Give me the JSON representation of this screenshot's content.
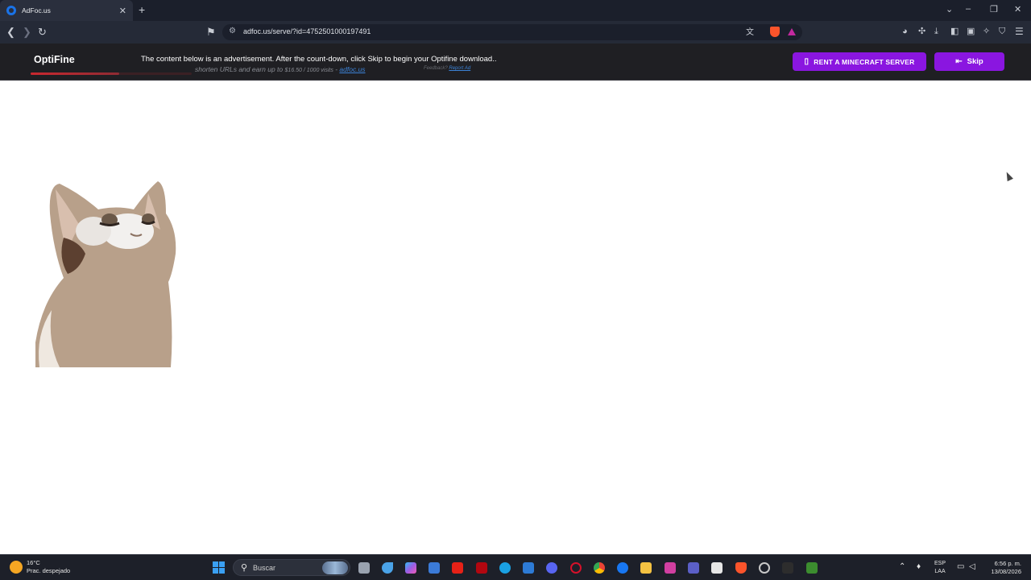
{
  "browser": {
    "tab_title": "AdFoc.us",
    "url": "adfoc.us/serve/?id=4752501000197491"
  },
  "adbar": {
    "brand": "OptiFine",
    "message": "The content below is an advertisement. After the count-down, click Skip to begin your Optifine download..",
    "sub_text": "shorten URLs and earn up to",
    "sub_rate": "$16.50 / 1000 visits",
    "sub_dash": " - ",
    "sub_link": "adfoc.us",
    "feedback_label": "Feedback?",
    "feedback_link": "Report Ad",
    "countdown_progress": 0.55,
    "rent_button": "RENT A MINECRAFT SERVER",
    "skip_button": "Skip"
  },
  "taskbar": {
    "weather_temp": "16°C",
    "weather_desc": "Prac. despejado",
    "search_placeholder": "Buscar",
    "lang_1": "ESP",
    "lang_2": "LAA",
    "time": "6:56 p. m.",
    "date": "13/08/2026"
  },
  "colors": {
    "accent_purple": "#8a16e0",
    "progress_red": "#c9282f",
    "link_blue": "#3b82d6"
  }
}
